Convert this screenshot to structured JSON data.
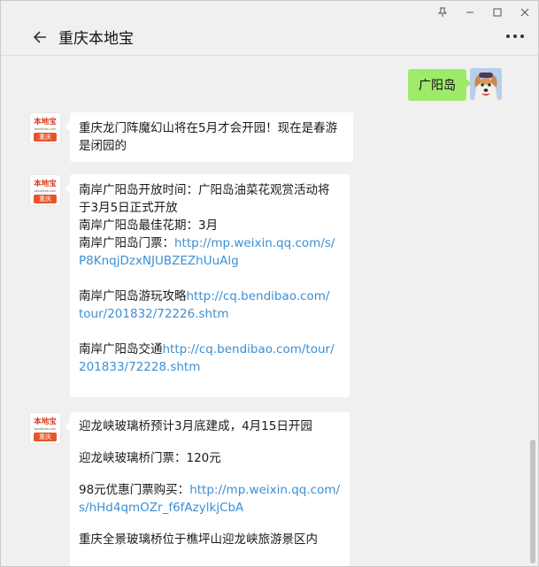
{
  "window": {
    "controls": [
      "pin",
      "minimize",
      "maximize",
      "close"
    ]
  },
  "header": {
    "title": "重庆本地宝",
    "back_icon": "back-arrow-icon",
    "more_icon": "more-icon"
  },
  "messages": {
    "mine": {
      "text": "广阳岛"
    },
    "logo": {
      "top": "本地宝",
      "url": "bendibao.com",
      "city": "重庆"
    },
    "m1": {
      "l1": "重庆龙门阵魔幻山将在5月才会开园！现在是春游",
      "l2": "是闭园的"
    },
    "m2": {
      "l1": "南岸广阳岛开放时间：广阳岛油菜花观赏活动将",
      "l2": "于3月5日正式开放",
      "l3": "南岸广阳岛最佳花期：3月",
      "l4_text": "南岸广阳岛门票：",
      "l4_link": "http://mp.weixin.qq.com/s/",
      "l5_link": "P8KnqjDzxNJUBZEZhUuAlg",
      "l6_text": "南岸广阳岛游玩攻略",
      "l6_link": "http://cq.bendibao.com/",
      "l7_link": "tour/201832/72226.shtm",
      "l8_text": "南岸广阳岛交通",
      "l8_link": "http://cq.bendibao.com/tour/",
      "l9_link": "201833/72228.shtm"
    },
    "m3": {
      "l1": "迎龙峡玻璃桥预计3月底建成，4月15日开园",
      "l2": "迎龙峡玻璃桥门票：120元",
      "l3_text": "98元优惠门票购买：",
      "l3_link": "http://mp.weixin.qq.com/",
      "l4_link": "s/hHd4qmOZr_f6fAzylkjCbA",
      "l5": "重庆全景玻璃桥位于樵坪山迎龙峡旅游景区内"
    }
  }
}
